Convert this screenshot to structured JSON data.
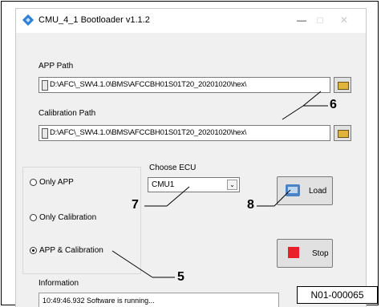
{
  "window": {
    "title": "CMU_4_1 Bootloader v1.1.2",
    "minimize_glyph": "—",
    "maximize_glyph": "□",
    "close_glyph": "✕",
    "app_icon": "diamond-app-icon"
  },
  "app_path": {
    "label": "APP Path",
    "value": "D:\\AFC\\_SW\\4.1.0\\BMS\\AFCCBH01S01T20_20201020\\hex\\"
  },
  "calibration_path": {
    "label": "Calibration Path",
    "value": "D:\\AFC\\_SW\\4.1.0\\BMS\\AFCCBH01S01T20_20201020\\hex\\"
  },
  "mode": {
    "options": [
      "Only APP",
      "Only Calibration",
      "APP & Calibration"
    ],
    "selected": "APP & Calibration"
  },
  "ecu": {
    "label": "Choose ECU",
    "selected": "CMU1",
    "caret": "⌄"
  },
  "buttons": {
    "load": "Load",
    "stop": "Stop"
  },
  "information": {
    "label": "Information",
    "log_line": "10:49:46.932 Software is running..."
  },
  "callouts": {
    "c5": "5",
    "c6": "6",
    "c7": "7",
    "c8": "8"
  },
  "figure_ref": "N01-000065",
  "colors": {
    "accent_blue": "#2f7fd6",
    "stop_red": "#e8202a",
    "folder_yellow": "#e0b43a",
    "window_bg": "#f0f0f0"
  }
}
